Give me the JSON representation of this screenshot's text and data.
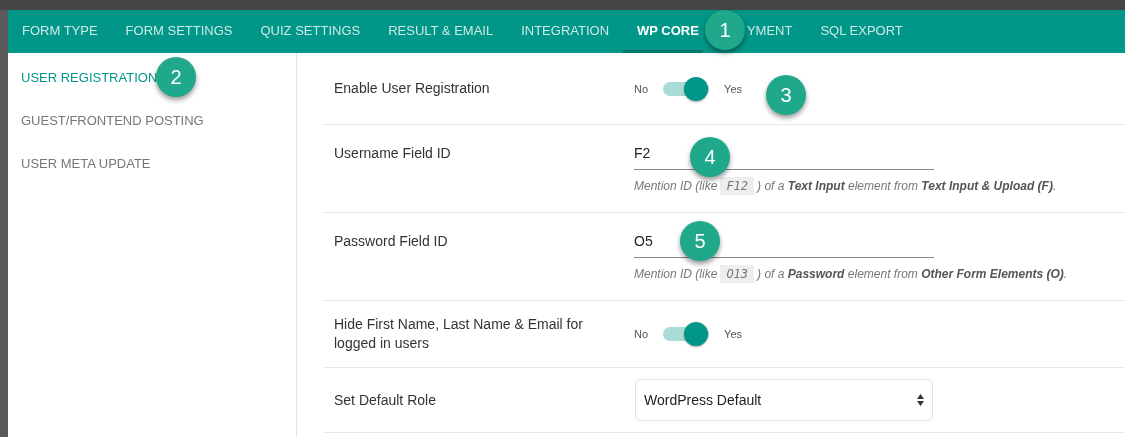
{
  "tabs": [
    {
      "label": "FORM TYPE",
      "selected": false
    },
    {
      "label": "FORM SETTINGS",
      "selected": false
    },
    {
      "label": "QUIZ SETTINGS",
      "selected": false
    },
    {
      "label": "RESULT & EMAIL",
      "selected": false
    },
    {
      "label": "INTEGRATION",
      "selected": false
    },
    {
      "label": "WP CORE",
      "selected": true
    },
    {
      "label": "YMENT",
      "selected": false
    },
    {
      "label": "SQL EXPORT",
      "selected": false
    }
  ],
  "sidebar": {
    "items": [
      {
        "label": "USER REGISTRATION",
        "selected": true
      },
      {
        "label": "GUEST/FRONTEND POSTING",
        "selected": false
      },
      {
        "label": "USER META UPDATE",
        "selected": false
      }
    ]
  },
  "settings": [
    {
      "kind": "toggle",
      "label": "Enable User Registration",
      "off_label": "No",
      "on_label": "Yes",
      "on": true
    },
    {
      "kind": "text",
      "label": "Username Field ID",
      "value": "F2",
      "help_before": "Mention ID (like",
      "example": "F12",
      "help_after": ") of a **Text Input** element from **Text Input & Upload (F)**."
    },
    {
      "kind": "text",
      "label": "Password Field ID",
      "value": "O5",
      "help_before": "Mention ID (like",
      "example": "O13",
      "help_after": ") of a **Password** element from **Other Form Elements (O)**."
    },
    {
      "kind": "toggle",
      "label": "Hide First Name, Last Name & Email for logged in users",
      "off_label": "No",
      "on_label": "Yes",
      "on": true
    },
    {
      "kind": "select",
      "label": "Set Default Role",
      "value": "WordPress Default"
    }
  ],
  "badges": [
    "1",
    "2",
    "3",
    "4",
    "5"
  ]
}
